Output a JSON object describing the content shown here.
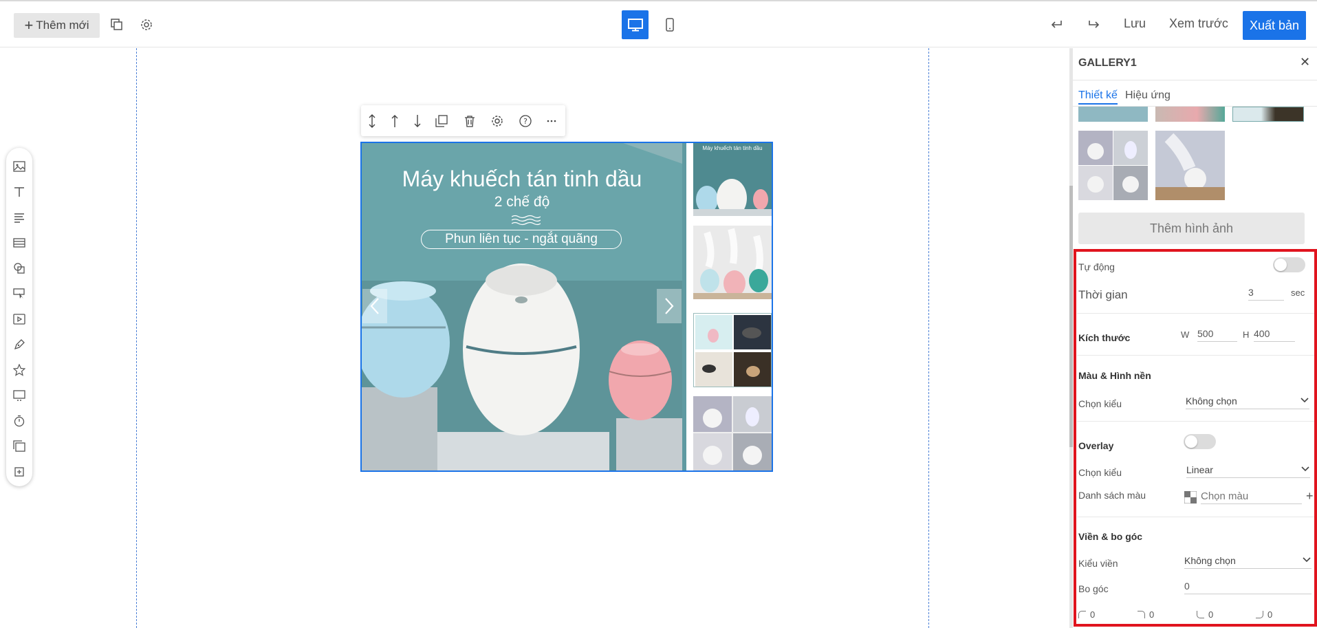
{
  "topbar": {
    "new_label": "Thêm mới",
    "save_label": "Lưu",
    "preview_label": "Xem trước",
    "publish_label": "Xuất bản",
    "accent": "#1a73e8"
  },
  "left_toolbar": {
    "icons": [
      "image-icon",
      "text-icon",
      "paragraph-icon",
      "section-icon",
      "shapes-icon",
      "button-cursor-icon",
      "video-icon",
      "pen-icon",
      "star-icon",
      "slideshow-icon",
      "timer-icon",
      "gallery-icon",
      "frame-icon"
    ]
  },
  "element_toolbar": {
    "icons": [
      "resize-vertical-icon",
      "move-up-icon",
      "move-down-icon",
      "duplicate-icon",
      "delete-icon",
      "settings-icon",
      "help-icon",
      "more-icon"
    ]
  },
  "gallery": {
    "title": "Máy khuếch tán tinh dầu",
    "subtitle": "2 chế độ",
    "pill": "Phun liên tục - ngắt quãng",
    "thumb1_caption": "Máy khuếch tán tinh dầu"
  },
  "panel": {
    "title": "GALLERY1",
    "tabs": [
      {
        "label": "Thiết kế",
        "active": true
      },
      {
        "label": "Hiệu ứng",
        "active": false
      }
    ],
    "add_image": "Thêm hình ảnh",
    "auto_label": "Tự động",
    "time_label": "Thời gian",
    "time_value": "3",
    "time_unit": "sec",
    "size_label": "Kích thước",
    "w_label": "W",
    "w_value": "500",
    "h_label": "H",
    "h_value": "400",
    "color_bg_label": "Màu & Hình nền",
    "choose_style_label": "Chọn kiểu",
    "bg_style_value": "Không chọn",
    "overlay_label": "Overlay",
    "overlay_style_label": "Chọn kiểu",
    "overlay_style_value": "Linear",
    "color_list_label": "Danh sách màu",
    "color_placeholder": "Chọn màu",
    "border_section_label": "Viền & bo góc",
    "border_style_label": "Kiểu viền",
    "border_style_value": "Không chọn",
    "radius_label": "Bo góc",
    "radius_value": "0",
    "corners": [
      "0",
      "0",
      "0",
      "0"
    ],
    "highlight_color": "#e0141e"
  }
}
